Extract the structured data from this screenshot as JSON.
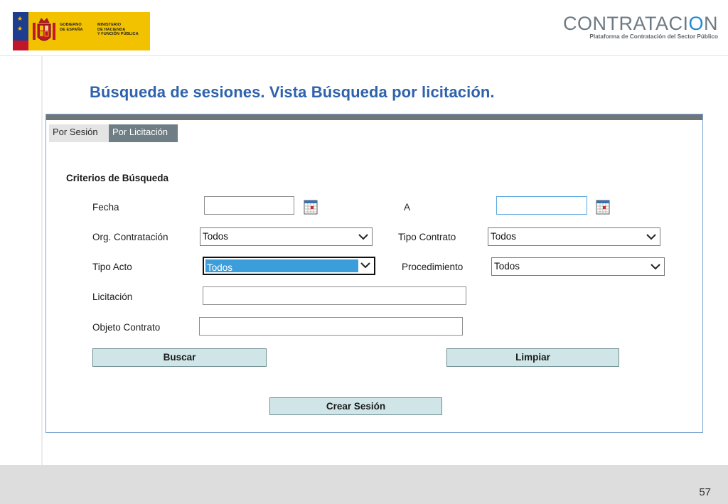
{
  "header": {
    "gov_text_1": "GOBIERNO\nDE ESPAÑA",
    "gov_text_2": "MINISTERIO\nDE HACIENDA\nY FUNCIÓN PÚBLICA",
    "brand_left": "CONTRATACI",
    "brand_power": "O",
    "brand_right": "N",
    "brand_sub": "Plataforma de Contratación del Sector Público"
  },
  "title": "Búsqueda de sesiones. Vista Búsqueda por licitación.",
  "tabs": [
    {
      "label": "Por Sesión",
      "active": false
    },
    {
      "label": "Por Licitación",
      "active": true
    }
  ],
  "form": {
    "section_title": "Criterios de Búsqueda",
    "fecha_label": "Fecha",
    "fecha_value": "",
    "a_label": "A",
    "a_value": "",
    "org_label": "Org. Contratación",
    "org_value": "Todos",
    "tipo_contrato_label": "Tipo Contrato",
    "tipo_contrato_value": "Todos",
    "tipo_acto_label": "Tipo Acto",
    "tipo_acto_value": "Todos",
    "procedimiento_label": "Procedimiento",
    "procedimiento_value": "Todos",
    "licitacion_label": "Licitación",
    "licitacion_value": "",
    "objeto_label": "Objeto Contrato",
    "objeto_value": ""
  },
  "buttons": {
    "buscar": "Buscar",
    "limpiar": "Limpiar",
    "crear_sesion": "Crear Sesión"
  },
  "colors": {
    "title": "#2e62ad",
    "button_bg": "#cfe5e7",
    "active_tab": "#6f7d85",
    "select_highlight": "#3c9ddb"
  },
  "page_number": "57"
}
